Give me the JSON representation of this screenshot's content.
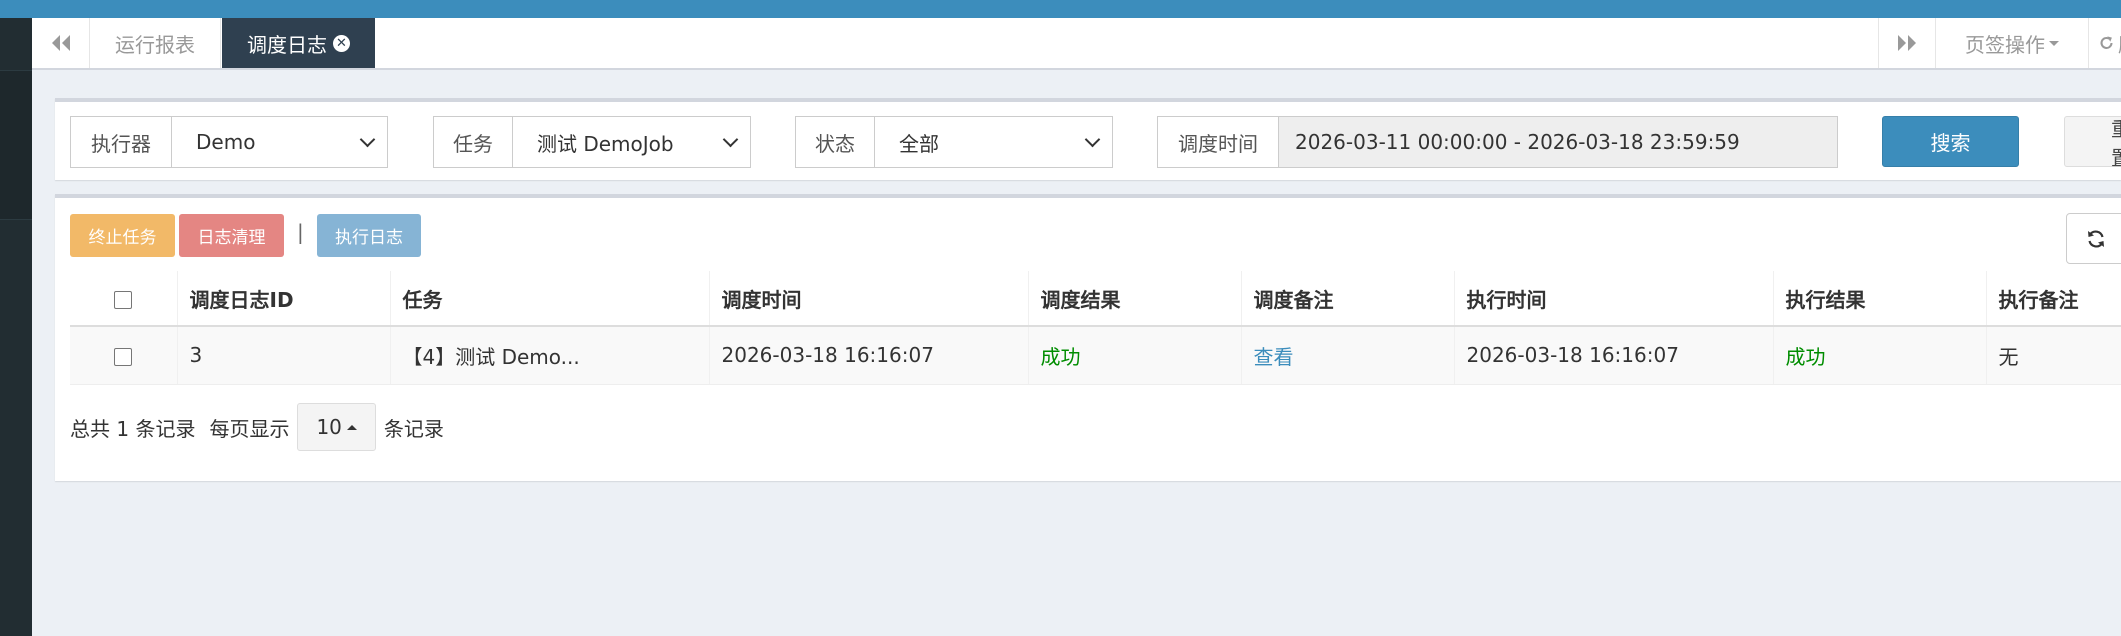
{
  "tabs": {
    "items": [
      {
        "label": "运行报表",
        "active": false
      },
      {
        "label": "调度日志",
        "active": true
      }
    ],
    "page_ops_label": "页签操作",
    "refresh_label": "刷新"
  },
  "filters": {
    "executor": {
      "label": "执行器",
      "value": "Demo"
    },
    "job": {
      "label": "任务",
      "value": "测试 DemoJob"
    },
    "status": {
      "label": "状态",
      "value": "全部"
    },
    "time": {
      "label": "调度时间",
      "value": "2026-03-11 00:00:00 - 2026-03-18 23:59:59"
    },
    "search_label": "搜索",
    "reset_label": "重置"
  },
  "toolbar": {
    "stop_label": "终止任务",
    "clear_label": "日志清理",
    "separator": "|",
    "exec_log_label": "执行日志"
  },
  "table": {
    "headers": [
      "调度日志ID",
      "任务",
      "调度时间",
      "调度结果",
      "调度备注",
      "执行时间",
      "执行结果",
      "执行备注"
    ],
    "rows": [
      {
        "id": "3",
        "job": "【4】测试 Demo...",
        "trigger_time": "2026-03-18 16:16:07",
        "trigger_result": "成功",
        "trigger_note": "查看",
        "exec_time": "2026-03-18 16:16:07",
        "exec_result": "成功",
        "exec_note": "无"
      }
    ]
  },
  "pagination": {
    "total_text": "总共 1 条记录",
    "per_page_label": "每页显示",
    "page_size": "10",
    "unit_label": "条记录"
  },
  "colors": {
    "header_blue": "#3c8dbc",
    "sidebar": "#222d32",
    "active_tab": "#2f4050",
    "success_green": "#008d00",
    "warning": "#f0ad4e",
    "danger": "#d9534f"
  },
  "icons": [
    "backward-icon",
    "close-circle-icon",
    "forward-icon",
    "caret-down-icon",
    "refresh-icon",
    "checkbox",
    "caret-up-icon"
  ]
}
